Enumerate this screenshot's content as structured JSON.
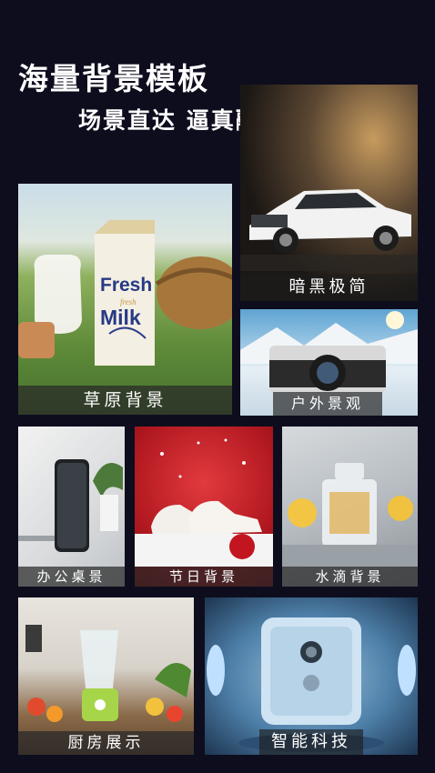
{
  "header": {
    "title": "海量背景模板",
    "subtitle": "场景直达  逼真融合"
  },
  "cards": {
    "dark": {
      "label": "暗黑极简"
    },
    "grass": {
      "label": "草原背景",
      "carton_line1": "Fresh",
      "carton_line2": "fresh",
      "carton_line3": "Milk"
    },
    "outdoor": {
      "label": "户外景观"
    },
    "office": {
      "label": "办公桌景"
    },
    "holiday": {
      "label": "节日背景"
    },
    "water": {
      "label": "水滴背景"
    },
    "kitchen": {
      "label": "厨房展示"
    },
    "tech": {
      "label": "智能科技"
    }
  }
}
